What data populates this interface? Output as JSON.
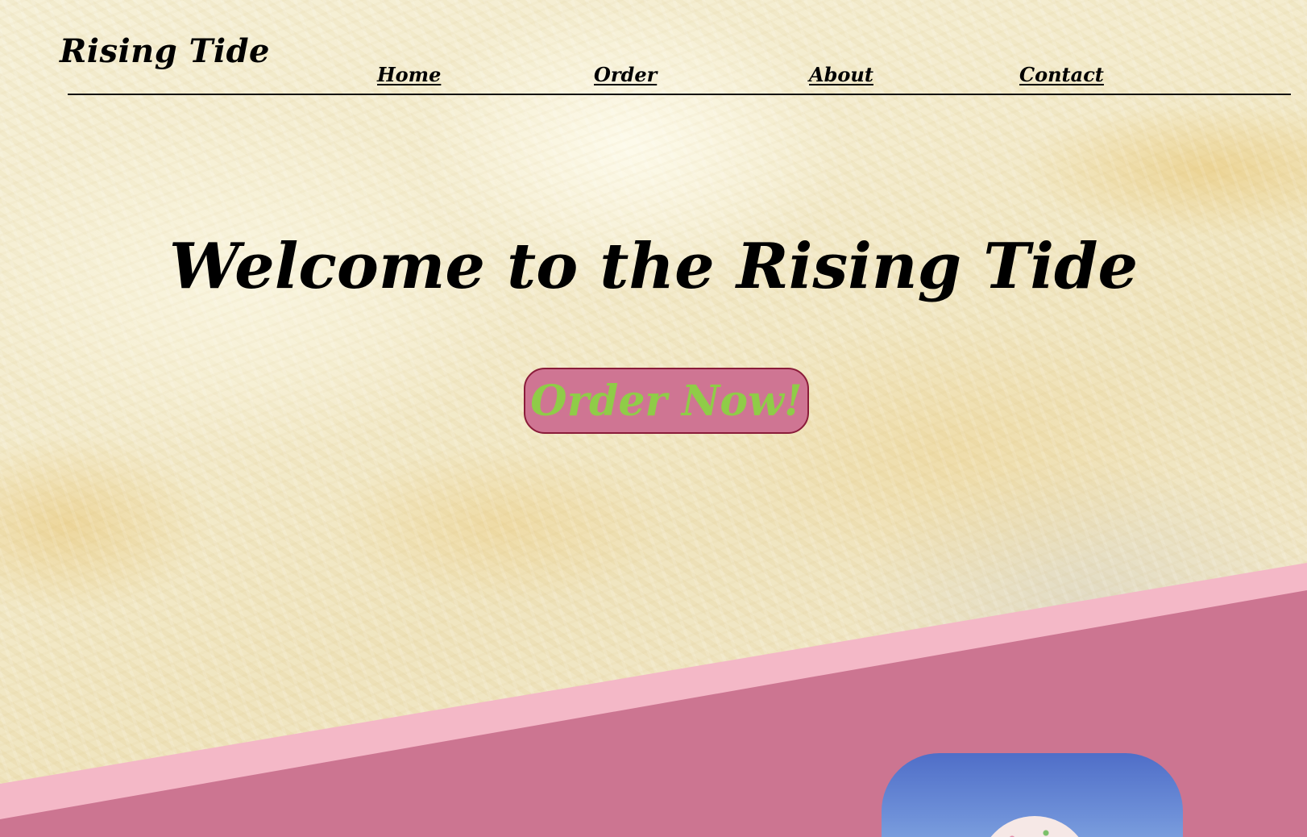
{
  "brand": {
    "name": "Rising Tide"
  },
  "nav": {
    "items": [
      {
        "label": "Home"
      },
      {
        "label": "Order"
      },
      {
        "label": "About"
      },
      {
        "label": "Contact"
      }
    ]
  },
  "hero": {
    "title": "Welcome to the Rising Tide",
    "cta_label": "Order Now!"
  },
  "theme": {
    "accent_pink": "#cc7591",
    "band_light_pink": "#f4b8c7",
    "cta_text_green": "#8fcc48",
    "cta_border": "#8a1c3a",
    "text": "#000000"
  },
  "icons": {
    "promo_image": "ice-cream-photo"
  }
}
